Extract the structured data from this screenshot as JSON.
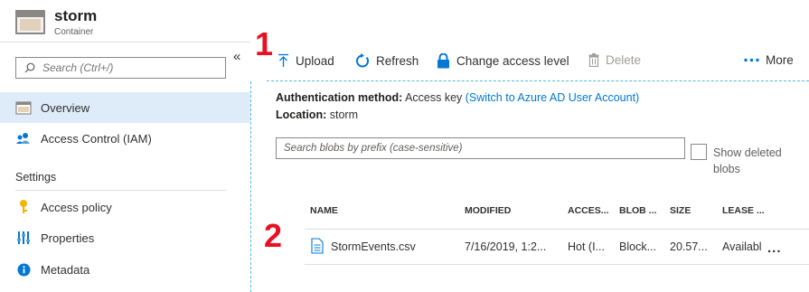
{
  "header": {
    "title": "storm",
    "subtitle": "Container"
  },
  "sidebar": {
    "search_placeholder": "Search (Ctrl+/)",
    "collapse_glyph": "«",
    "items": [
      {
        "label": "Overview",
        "icon": "overview-icon",
        "active": true
      },
      {
        "label": "Access Control (IAM)",
        "icon": "iam-icon"
      }
    ],
    "settings_label": "Settings",
    "settings_items": [
      {
        "label": "Access policy",
        "icon": "key-icon"
      },
      {
        "label": "Properties",
        "icon": "properties-icon"
      },
      {
        "label": "Metadata",
        "icon": "info-icon"
      }
    ]
  },
  "toolbar": {
    "upload": "Upload",
    "refresh": "Refresh",
    "change_access": "Change access level",
    "delete": "Delete",
    "more": "More"
  },
  "annotations": {
    "one": "1",
    "two": "2"
  },
  "info": {
    "auth_label": "Authentication method:",
    "auth_value": "Access key",
    "auth_link": "(Switch to Azure AD User Account)",
    "location_label": "Location:",
    "location_value": "storm"
  },
  "blob_search_placeholder": "Search blobs by prefix (case-sensitive)",
  "show_deleted": "Show deleted blobs",
  "table": {
    "columns": [
      "NAME",
      "MODIFIED",
      "ACCES...",
      "BLOB ...",
      "SIZE",
      "LEASE ..."
    ],
    "rows": [
      {
        "name": "StormEvents.csv",
        "modified": "7/16/2019, 1:2...",
        "access": "Hot (I...",
        "blob": "Block...",
        "size": "20.57...",
        "lease": "Availabl",
        "more": "..."
      }
    ]
  },
  "colors": {
    "accent": "#0078d4",
    "active_bg": "#deecf9",
    "annotation": "#e81123"
  }
}
